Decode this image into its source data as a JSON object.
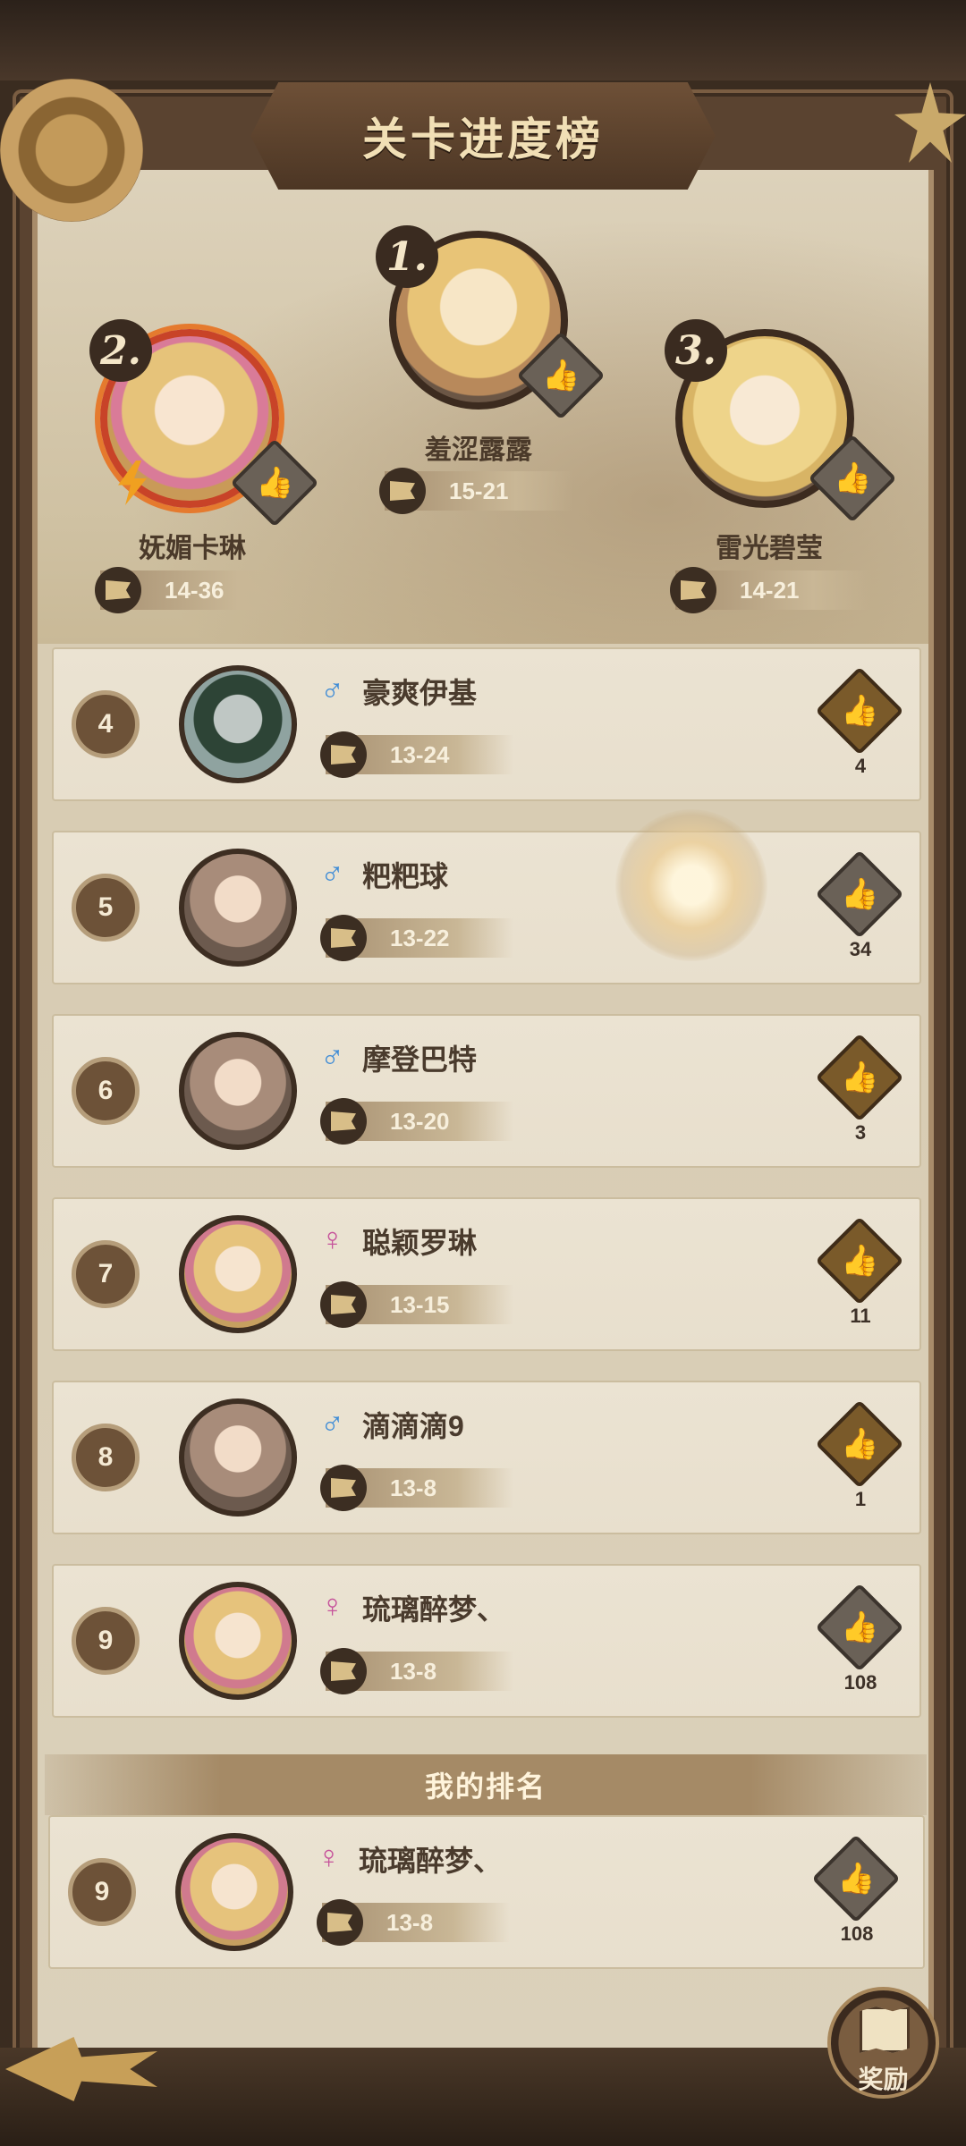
{
  "title": "关卡进度榜",
  "podium": [
    {
      "rank": "1.",
      "name": "羞涩露露",
      "stage": "15-21"
    },
    {
      "rank": "2.",
      "name": "妩媚卡琳",
      "stage": "14-36"
    },
    {
      "rank": "3.",
      "name": "雷光碧莹",
      "stage": "14-21"
    }
  ],
  "rows": [
    {
      "rank": "4",
      "gender": "♂",
      "name": "豪爽伊基",
      "stage": "13-24",
      "likes": "4"
    },
    {
      "rank": "5",
      "gender": "♂",
      "name": "粑粑球",
      "stage": "13-22",
      "likes": "34"
    },
    {
      "rank": "6",
      "gender": "♂",
      "name": "摩登巴特",
      "stage": "13-20",
      "likes": "3"
    },
    {
      "rank": "7",
      "gender": "♀",
      "name": "聪颖罗琳",
      "stage": "13-15",
      "likes": "11"
    },
    {
      "rank": "8",
      "gender": "♂",
      "name": "滴滴滴9",
      "stage": "13-8",
      "likes": "1"
    },
    {
      "rank": "9",
      "gender": "♀",
      "name": "琉璃醉梦、",
      "stage": "13-8",
      "likes": "108"
    }
  ],
  "my_rank_label": "我的排名",
  "my_rank": {
    "rank": "9",
    "gender": "♀",
    "name": "琉璃醉梦、",
    "stage": "13-8",
    "likes": "108"
  },
  "reward_label": "奖励",
  "icons": {
    "like": "thumbs-up-icon",
    "stage": "flag-icon",
    "back": "back-arrow-icon",
    "reward": "map-icon"
  },
  "colors": {
    "male": "#3f8cd6",
    "female": "#c6539b",
    "title_text": "#f1dfb5"
  }
}
